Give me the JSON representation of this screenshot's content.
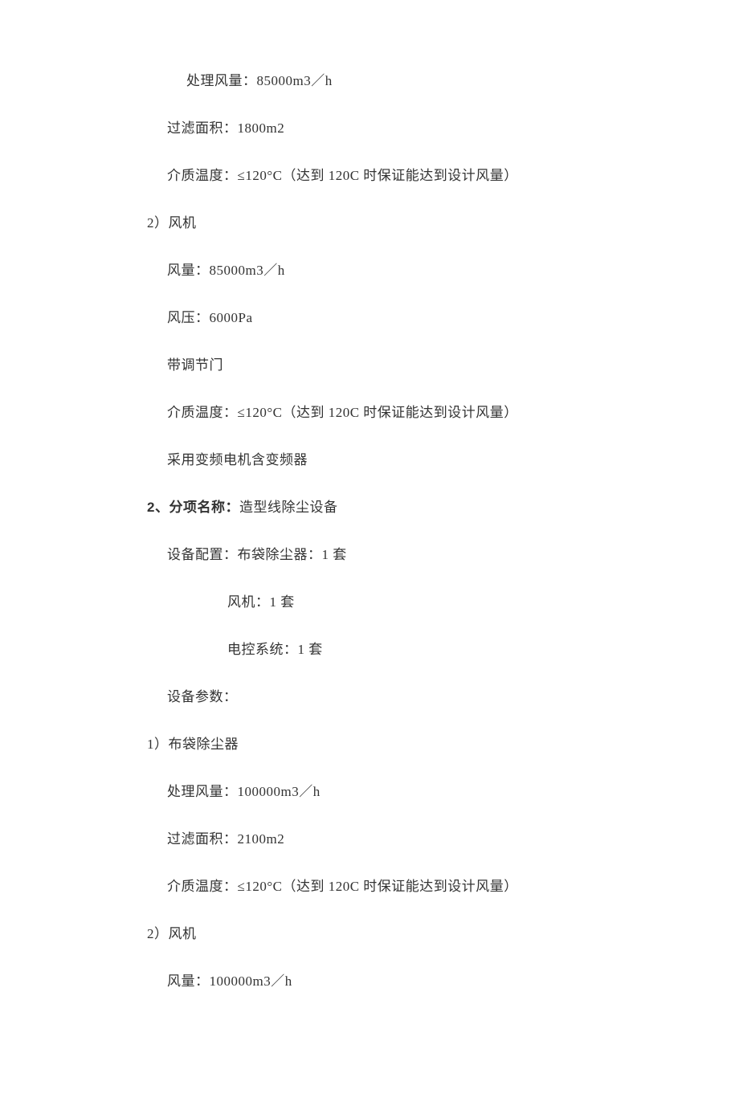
{
  "lines": [
    {
      "indent": 2,
      "runs": [
        {
          "text": "处理风量：85000m3／h"
        }
      ]
    },
    {
      "indent": 1,
      "runs": [
        {
          "text": "过滤面积：1800m2"
        }
      ]
    },
    {
      "indent": 1,
      "runs": [
        {
          "text": "介质温度：≤120°C（达到 120C 时保证能达到设计风量）"
        }
      ]
    },
    {
      "indent": 0,
      "runs": [
        {
          "text": "2）风机"
        }
      ]
    },
    {
      "indent": 1,
      "runs": [
        {
          "text": "风量：85000m3／h"
        }
      ]
    },
    {
      "indent": 1,
      "runs": [
        {
          "text": "风压：6000Pa"
        }
      ]
    },
    {
      "indent": 1,
      "runs": [
        {
          "text": "带调节门"
        }
      ]
    },
    {
      "indent": 1,
      "runs": [
        {
          "text": "介质温度：≤120°C（达到 120C 时保证能达到设计风量）"
        }
      ]
    },
    {
      "indent": 1,
      "runs": [
        {
          "text": "采用变频电机含变频器"
        }
      ]
    },
    {
      "indent": 0,
      "runs": [
        {
          "text": "2、分项名称：",
          "bold": true
        },
        {
          "text": "造型线除尘设备"
        }
      ]
    },
    {
      "indent": 1,
      "runs": [
        {
          "text": "设备配置：布袋除尘器：1 套"
        }
      ]
    },
    {
      "indent": 3,
      "runs": [
        {
          "text": "风机：1 套"
        }
      ]
    },
    {
      "indent": 3,
      "runs": [
        {
          "text": "电控系统：1 套"
        }
      ]
    },
    {
      "indent": 1,
      "runs": [
        {
          "text": "设备参数："
        }
      ]
    },
    {
      "indent": 0,
      "runs": [
        {
          "text": "1）布袋除尘器"
        }
      ]
    },
    {
      "indent": 1,
      "runs": [
        {
          "text": "处理风量：100000m3／h"
        }
      ]
    },
    {
      "indent": 1,
      "runs": [
        {
          "text": "过滤面积：2100m2"
        }
      ]
    },
    {
      "indent": 1,
      "runs": [
        {
          "text": "介质温度：≤120°C（达到 120C 时保证能达到设计风量）"
        }
      ]
    },
    {
      "indent": 0,
      "runs": [
        {
          "text": "2）风机"
        }
      ]
    },
    {
      "indent": 1,
      "runs": [
        {
          "text": "风量：100000m3／h"
        }
      ]
    }
  ]
}
